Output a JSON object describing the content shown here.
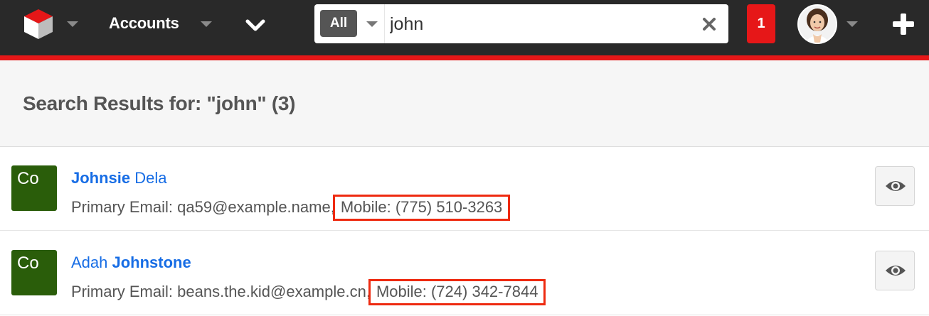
{
  "navbar": {
    "logo_icon": "cube-logo-icon",
    "module_tab_label": "Accounts",
    "more_icon": "chevron-down-icon",
    "search": {
      "filter_label": "All",
      "query": "john",
      "clear_icon": "close-icon"
    },
    "notification_count": "1",
    "avatar_icon": "user-avatar",
    "create_icon": "plus-icon"
  },
  "results": {
    "title": "Search Results for: \"john\" (3)",
    "items": [
      {
        "module_abbr": "Co",
        "name_bold": "Johnsie",
        "name_rest": " Dela",
        "details_prefix": "Primary Email: qa59@example.name,",
        "mobile": "Mobile: (775) 510-3263",
        "preview_icon": "eye-icon"
      },
      {
        "module_abbr": "Co",
        "name_rest_before": "Adah ",
        "name_bold": "Johnstone",
        "details_prefix": "Primary Email: beans.the.kid@example.cn,",
        "mobile": "Mobile: (724) 342-7844",
        "preview_icon": "eye-icon"
      }
    ]
  },
  "colors": {
    "navbar_bg": "#292929",
    "accent_red": "#e61718",
    "link_blue": "#176de5",
    "module_badge_green": "#2a5d0a",
    "highlight_red": "#ee2a10"
  }
}
